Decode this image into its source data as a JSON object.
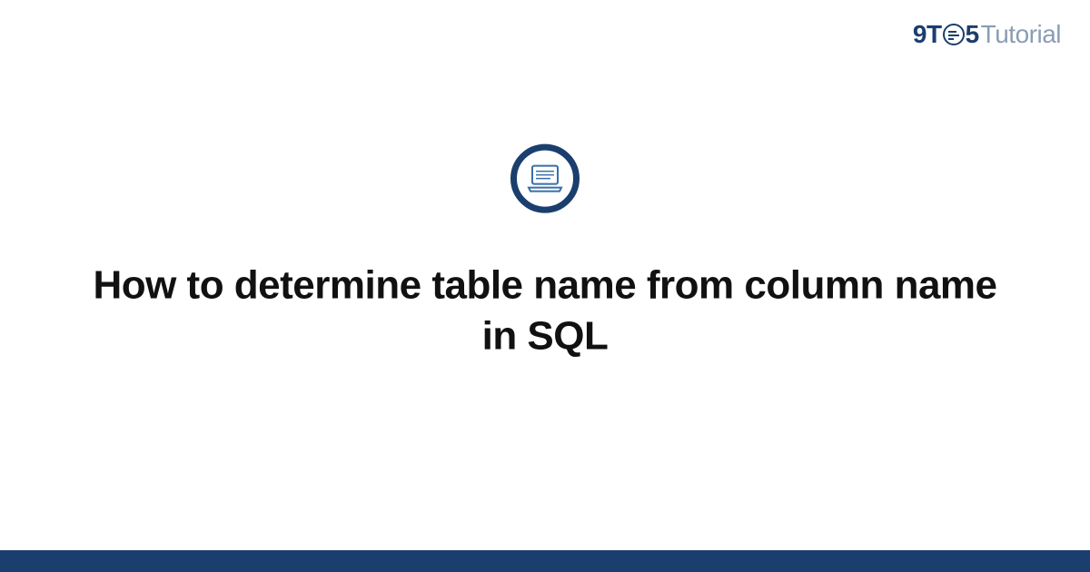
{
  "logo": {
    "nine": "9",
    "t": "T",
    "five": "5",
    "tutorial": "Tutorial"
  },
  "heading": "How to determine table name from column name in SQL",
  "colors": {
    "primary": "#1a3e6e",
    "secondary": "#8a9db5"
  }
}
